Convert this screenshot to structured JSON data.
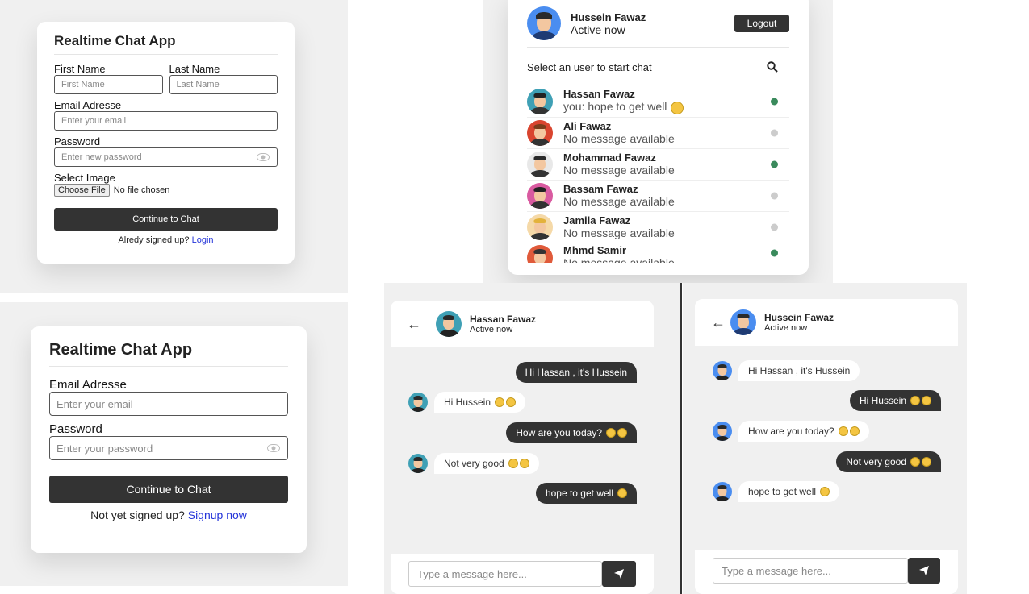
{
  "signup": {
    "title": "Realtime Chat App",
    "first_name_label": "First Name",
    "first_name_placeholder": "First Name",
    "last_name_label": "Last Name",
    "last_name_placeholder": "Last Name",
    "email_label": "Email Adresse",
    "email_placeholder": "Enter your email",
    "password_label": "Password",
    "password_placeholder": "Enter new password",
    "image_label": "Select Image",
    "choose_file": "Choose File",
    "no_file": "No file chosen",
    "submit": "Continue to Chat",
    "footer_text": "Alredy signed up?",
    "footer_link": "Login"
  },
  "login": {
    "title": "Realtime Chat App",
    "email_label": "Email Adresse",
    "email_placeholder": "Enter your email",
    "password_label": "Password",
    "password_placeholder": "Enter your password",
    "submit": "Continue to Chat",
    "footer_text": "Not yet signed up?",
    "footer_link": "Signup now"
  },
  "users": {
    "me_name": "Hussein Fawaz",
    "me_status": "Active now",
    "logout": "Logout",
    "search_prompt": "Select an user to start chat",
    "list": [
      {
        "name": "Hassan Fawaz",
        "msg": "you: hope to get well",
        "online": true
      },
      {
        "name": "Ali Fawaz",
        "msg": "No message available",
        "online": false
      },
      {
        "name": "Mohammad Fawaz",
        "msg": "No message available",
        "online": true
      },
      {
        "name": "Bassam Fawaz",
        "msg": "No message available",
        "online": false
      },
      {
        "name": "Jamila Fawaz",
        "msg": "No message available",
        "online": false
      },
      {
        "name": "Mhmd Samir",
        "msg": "No message available",
        "online": true
      }
    ]
  },
  "chat_left": {
    "name": "Hassan Fawaz",
    "status": "Active now",
    "messages": [
      {
        "text": "Hi Hassan , it's Hussein",
        "dir": "out"
      },
      {
        "text": "Hi Hussein",
        "dir": "in"
      },
      {
        "text": "How are you today?",
        "dir": "out"
      },
      {
        "text": "Not very good",
        "dir": "in"
      },
      {
        "text": "hope to get well",
        "dir": "out"
      }
    ],
    "input_placeholder": "Type a message here..."
  },
  "chat_right": {
    "name": "Hussein Fawaz",
    "status": "Active now",
    "messages": [
      {
        "text": "Hi Hassan , it's Hussein",
        "dir": "in"
      },
      {
        "text": "Hi Hussein",
        "dir": "out"
      },
      {
        "text": "How are you today?",
        "dir": "in"
      },
      {
        "text": "Not very good",
        "dir": "out"
      },
      {
        "text": "hope to get well",
        "dir": "in"
      }
    ],
    "input_placeholder": "Type a message here..."
  },
  "colors": {
    "online": "#3a8a5c",
    "offline": "#cccccc",
    "dark": "#333333",
    "link": "#2434d9"
  }
}
